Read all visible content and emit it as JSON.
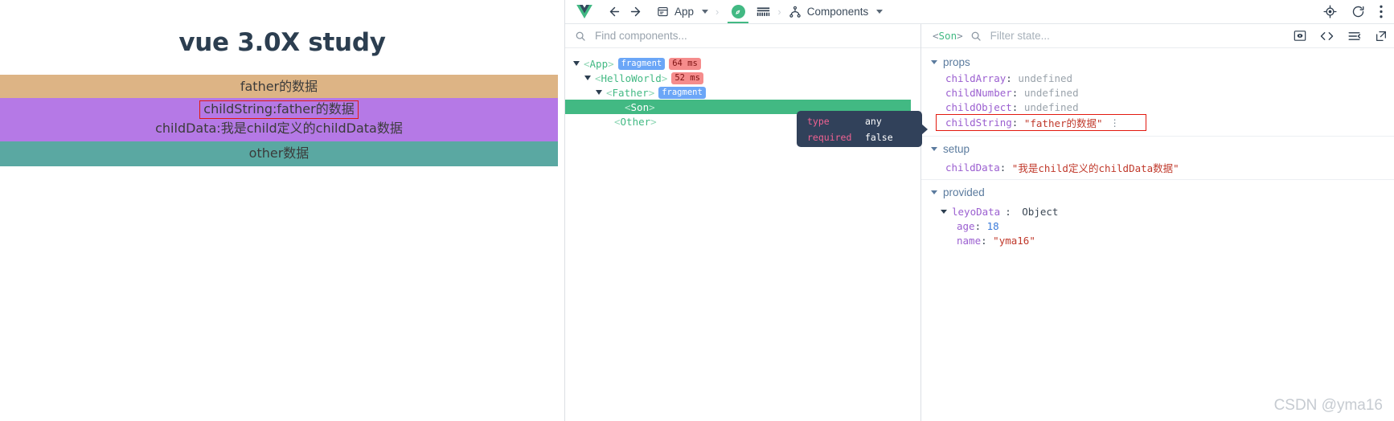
{
  "app_preview": {
    "title": "vue 3.0X study",
    "bands": [
      {
        "name": "father",
        "text": "father的数据",
        "color": "#ddb485"
      },
      {
        "name": "child-string",
        "text": "childString:father的数据",
        "color": "#b579e6",
        "highlighted": true
      },
      {
        "name": "child-data",
        "text": "childData:我是child定义的childData数据",
        "color": "#b579e6"
      },
      {
        "name": "other",
        "text": "other数据",
        "color": "#5aa8a2"
      }
    ]
  },
  "devtools": {
    "toolbar": {
      "logo": "vue-logo",
      "back_icon": "arrow-left-icon",
      "forward_icon": "arrow-right-icon",
      "app_label": "App",
      "app_icon": "window-icon",
      "app_caret": "chevron-down-icon",
      "separator": "›",
      "compass_icon": "compass-icon",
      "timeline_icon": "timeline-icon",
      "components_label": "Components",
      "components_icon": "component-tree-icon",
      "components_caret": "chevron-down-icon",
      "inspect_icon": "target-icon",
      "refresh_icon": "refresh-icon",
      "more_icon": "more-vertical-icon"
    },
    "tree_pane": {
      "search": {
        "value": "",
        "placeholder": "Find components...",
        "icon": "search-icon"
      },
      "nodes": [
        {
          "name": "<App>",
          "open_tag": "<",
          "label": "App",
          "close_tag": ">",
          "depth": 0,
          "expandable": true,
          "badges": [
            {
              "text": "fragment",
              "type": "fragment"
            },
            {
              "text": "64 ms",
              "type": "time"
            }
          ],
          "selected": false
        },
        {
          "name": "<HelloWorld>",
          "open_tag": "<",
          "label": "HelloWorld",
          "close_tag": ">",
          "depth": 1,
          "expandable": true,
          "badges": [
            {
              "text": "52 ms",
              "type": "time"
            }
          ],
          "selected": false
        },
        {
          "name": "<Father>",
          "open_tag": "<",
          "label": "Father",
          "close_tag": ">",
          "depth": 2,
          "expandable": true,
          "badges": [
            {
              "text": "fragment",
              "type": "fragment"
            }
          ],
          "selected": false
        },
        {
          "name": "<Son>",
          "open_tag": "<",
          "label": "Son",
          "close_tag": ">",
          "depth": 3,
          "expandable": false,
          "badges": [],
          "selected": true
        },
        {
          "name": "<Other>",
          "open_tag": "<",
          "label": "Other",
          "close_tag": ">",
          "depth": 2,
          "expandable": false,
          "badges": [],
          "selected": false
        }
      ]
    },
    "state_pane": {
      "selected_component": "Son",
      "selected_component_open": "<",
      "selected_component_close": ">",
      "filter": {
        "value": "",
        "placeholder": "Filter state...",
        "icon": "search-icon"
      },
      "icons": [
        "screenshot-icon",
        "code-icon",
        "collapse-icon",
        "open-external-icon"
      ],
      "groups": [
        {
          "title": "props",
          "rows": [
            {
              "key": "childArray",
              "value": "undefined",
              "value_type": "undefined",
              "highlighted": false
            },
            {
              "key": "childNumber",
              "value": "undefined",
              "value_type": "undefined",
              "highlighted": false
            },
            {
              "key": "childObject",
              "value": "undefined",
              "value_type": "undefined",
              "highlighted": false
            },
            {
              "key": "childString",
              "value": "\"father的数据\"",
              "value_type": "string",
              "highlighted": true,
              "menu_icon": "more-vertical-icon"
            }
          ]
        },
        {
          "title": "setup",
          "rows": [
            {
              "key": "childData",
              "value": "\"我是child定义的childData数据\"",
              "value_type": "string",
              "highlighted": false
            }
          ]
        },
        {
          "title": "provided",
          "rows": [
            {
              "key": "leyoData",
              "value": "Object",
              "value_type": "object",
              "expandable": true,
              "highlighted": false
            },
            {
              "key": "age",
              "value": "18",
              "value_type": "number",
              "indent": true,
              "highlighted": false
            },
            {
              "key": "name",
              "value": "\"yma16\"",
              "value_type": "string",
              "indent": true,
              "highlighted": false
            }
          ]
        }
      ]
    },
    "tooltip": {
      "rows": [
        {
          "key": "type",
          "value": "any"
        },
        {
          "key": "required",
          "value": "false"
        }
      ]
    }
  },
  "watermark": "CSDN @yma16"
}
